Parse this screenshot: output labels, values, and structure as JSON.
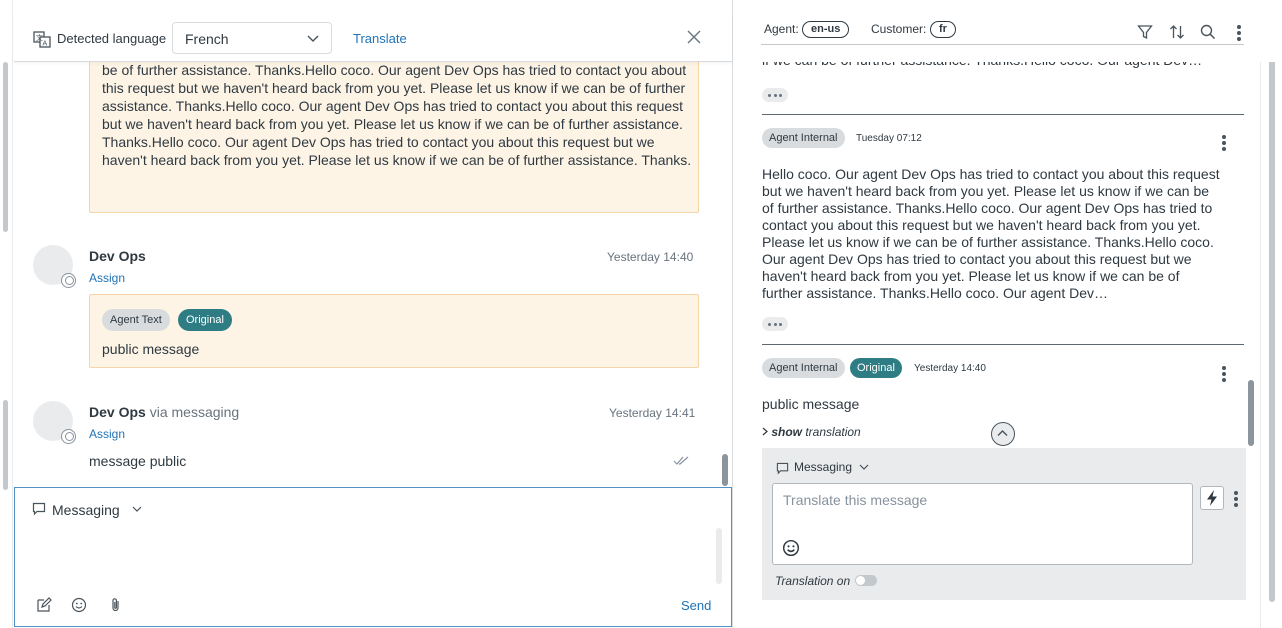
{
  "translation_bar": {
    "detected_label": "Detected language",
    "language": "French",
    "translate_link": "Translate"
  },
  "left_thread": {
    "translated_block": "be of further assistance. Thanks.Hello coco. Our agent Dev Ops has tried to contact you about this request but we haven't heard back from you yet. Please let us know if we can be of further assistance. Thanks.Hello coco. Our agent Dev Ops has tried to contact you about this request but we haven't heard back from you yet. Please let us know if we can be of further assistance. Thanks.Hello coco. Our agent Dev Ops has tried to contact you about this request but we haven't heard back from you yet. Please let us know if we can be of further assistance. Thanks.",
    "messages": [
      {
        "author": "Dev Ops",
        "via": "",
        "assign": "Assign",
        "time": "Yesterday 14:40",
        "tags": [
          "Agent Text",
          "Original"
        ],
        "body": "public message"
      },
      {
        "author": "Dev Ops",
        "via": "via messaging",
        "assign": "Assign",
        "time": "Yesterday 14:41",
        "body": "message public"
      }
    ]
  },
  "composer": {
    "channel": "Messaging",
    "send_label": "Send"
  },
  "right_header": {
    "agent_label": "Agent:",
    "agent_locale": "en-us",
    "customer_label": "Customer:",
    "customer_locale": "fr"
  },
  "right_thread": {
    "top_text": "if we can be of further assistance. Thanks.Hello coco. Our agent Dev…",
    "entry1": {
      "tag": "Agent Internal",
      "time": "Tuesday 07:12",
      "body": "Hello coco. Our agent Dev Ops has tried to contact you about this request but we haven't heard back from you yet. Please let us know if we can be of further assistance. Thanks.Hello coco. Our agent Dev Ops has tried to contact you about this request but we haven't heard back from you yet. Please let us know if we can be of further assistance. Thanks.Hello coco. Our agent Dev Ops has tried to contact you about this request but we haven't heard back from you yet. Please let us know if we can be of further assistance. Thanks.Hello coco. Our agent Dev…"
    },
    "entry2": {
      "tag": "Agent Internal",
      "tag2": "Original",
      "time": "Yesterday 14:40",
      "body": "public message",
      "show_bold": "show",
      "show_rest": " translation"
    }
  },
  "right_composer": {
    "channel": "Messaging",
    "placeholder": "Translate this message",
    "translation_label": "Translation on",
    "translation_on": false
  },
  "colors": {
    "link": "#1f73b7",
    "original_tag": "#2e7d84",
    "bubble_bg": "#fdf4e6",
    "bubble_border": "#f5d5a6"
  }
}
